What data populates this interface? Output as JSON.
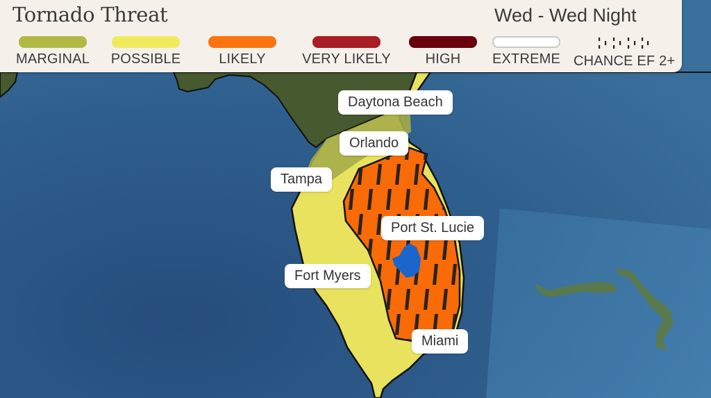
{
  "legend": {
    "title": "Tornado Threat",
    "period": "Wed - Wed Night",
    "items": [
      {
        "label": "MARGINAL",
        "color": "#b1b944",
        "style": "fill"
      },
      {
        "label": "POSSIBLE",
        "color": "#f0ea5e",
        "style": "fill"
      },
      {
        "label": "LIKELY",
        "color": "#fb7410",
        "style": "fill"
      },
      {
        "label": "VERY LIKELY",
        "color": "#a81e25",
        "style": "fill"
      },
      {
        "label": "HIGH",
        "color": "#68010c",
        "style": "fill"
      },
      {
        "label": "EXTREME",
        "color": "#ffffff",
        "style": "outline"
      },
      {
        "label": "CHANCE EF 2+",
        "color": "#222222",
        "style": "hatch"
      }
    ]
  },
  "map": {
    "colors": {
      "water": "#33628f",
      "land": "#4a5a34",
      "marginal": "#a6ad4a",
      "possible": "#e8e25e",
      "likely": "#f86b06",
      "lake": "#1a66cc",
      "hatch": "#2a2320",
      "islands": "#5d7a46"
    },
    "cities": [
      {
        "name": "Daytona Beach"
      },
      {
        "name": "Orlando"
      },
      {
        "name": "Tampa"
      },
      {
        "name": "Port St. Lucie"
      },
      {
        "name": "Fort Myers"
      },
      {
        "name": "Miami"
      }
    ]
  }
}
